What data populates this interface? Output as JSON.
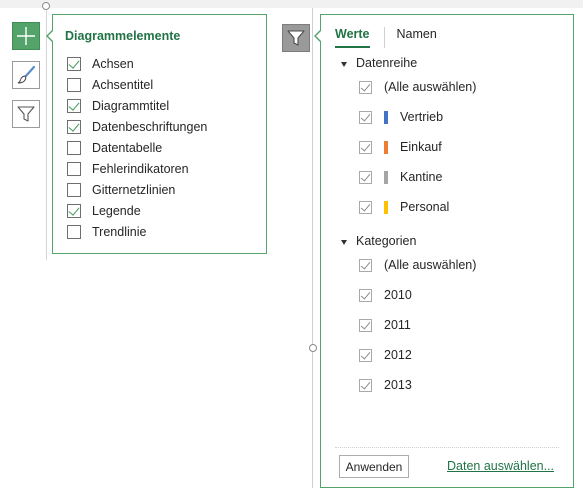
{
  "chart_elements": {
    "title": "Diagrammelemente",
    "items": [
      {
        "label": "Achsen",
        "checked": true
      },
      {
        "label": "Achsentitel",
        "checked": false
      },
      {
        "label": "Diagrammtitel",
        "checked": true
      },
      {
        "label": "Datenbeschriftungen",
        "checked": true
      },
      {
        "label": "Datentabelle",
        "checked": false
      },
      {
        "label": "Fehlerindikatoren",
        "checked": false
      },
      {
        "label": "Gitternetzlinien",
        "checked": false
      },
      {
        "label": "Legende",
        "checked": true
      },
      {
        "label": "Trendlinie",
        "checked": false
      }
    ]
  },
  "side_buttons": [
    "plus-icon",
    "brush-icon",
    "funnel-icon"
  ],
  "filter": {
    "tabs": [
      {
        "label": "Werte",
        "active": true
      },
      {
        "label": "Namen",
        "active": false
      }
    ],
    "sections": [
      {
        "label": "Datenreihe",
        "items": [
          {
            "label": "(Alle auswählen)",
            "color": null
          },
          {
            "label": "Vertrieb",
            "color": "#4472C4"
          },
          {
            "label": "Einkauf",
            "color": "#ED7D31"
          },
          {
            "label": "Kantine",
            "color": "#A5A5A5"
          },
          {
            "label": "Personal",
            "color": "#FFC000"
          }
        ]
      },
      {
        "label": "Kategorien",
        "items": [
          {
            "label": "(Alle auswählen)",
            "color": null
          },
          {
            "label": "2010",
            "color": null
          },
          {
            "label": "2011",
            "color": null
          },
          {
            "label": "2012",
            "color": null
          },
          {
            "label": "2013",
            "color": null
          }
        ]
      }
    ],
    "apply_label": "Anwenden",
    "select_data_link": "Daten auswählen..."
  },
  "colors": {
    "accent": "#217346",
    "panel_border": "#54a36a",
    "active_button": "#54a36a"
  }
}
